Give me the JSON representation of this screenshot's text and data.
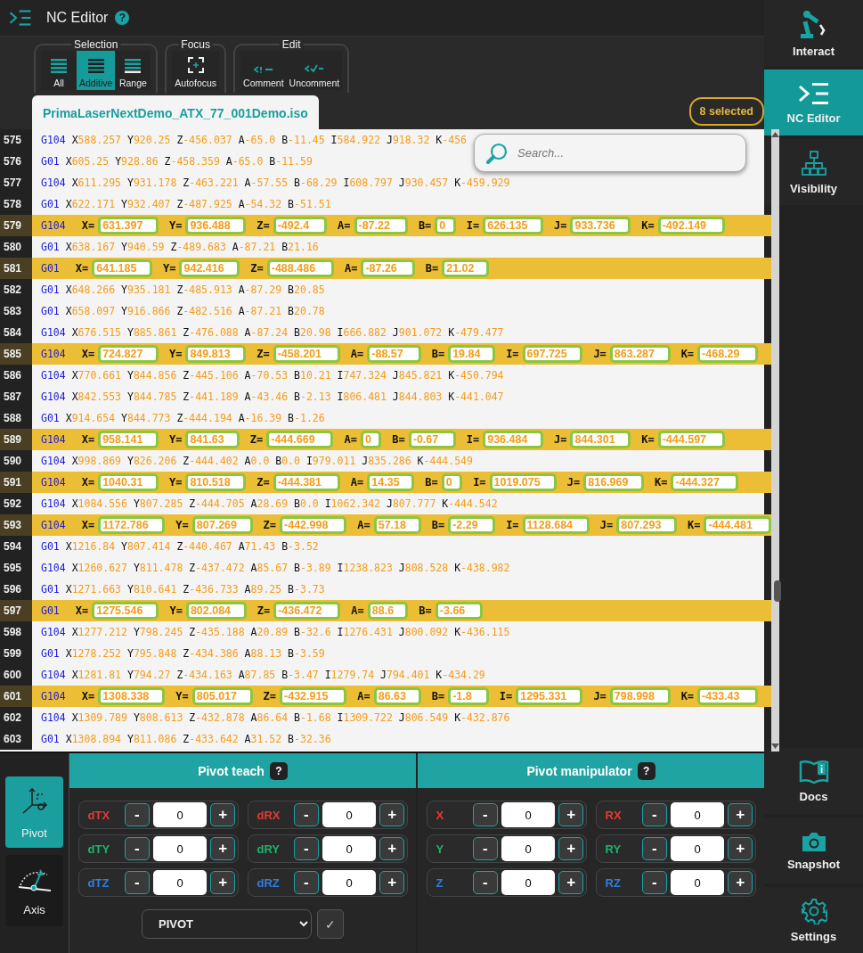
{
  "app": {
    "title": "NC Editor",
    "help": "?"
  },
  "toolbar": [
    {
      "label": "Selection",
      "buttons": [
        {
          "label": "All",
          "kind": "all",
          "selected": false
        },
        {
          "label": "Additive",
          "kind": "additive",
          "selected": true
        },
        {
          "label": "Range",
          "kind": "range",
          "selected": false
        }
      ]
    },
    {
      "label": "Focus",
      "buttons": [
        {
          "label": "Autofocus",
          "kind": "autofocus",
          "selected": false
        }
      ]
    },
    {
      "label": "Edit",
      "buttons": [
        {
          "label": "Comment",
          "kind": "comment",
          "selected": false
        },
        {
          "label": "Uncomment",
          "kind": "uncomment",
          "selected": false
        }
      ]
    }
  ],
  "file_tab": "PrimaLaserNextDemo_ATX_77_001Demo.iso",
  "selection_badge": "8 selected",
  "search": {
    "placeholder": "Search..."
  },
  "lines": [
    {
      "number": "575",
      "selected": false,
      "command": "G104",
      "params": [
        {
          "axis": "X",
          "value": "588.257"
        },
        {
          "axis": "Y",
          "value": "920.25"
        },
        {
          "axis": "Z",
          "value": "-456.037"
        },
        {
          "axis": "A",
          "value": "-65.0"
        },
        {
          "axis": "B",
          "value": "-11.45"
        },
        {
          "axis": "I",
          "value": "584.922"
        },
        {
          "axis": "J",
          "value": "918.32"
        },
        {
          "axis": "K",
          "value": "-456"
        }
      ]
    },
    {
      "number": "576",
      "selected": false,
      "command": "G01",
      "params": [
        {
          "axis": "X",
          "value": "605.25"
        },
        {
          "axis": "Y",
          "value": "928.86"
        },
        {
          "axis": "Z",
          "value": "-458.359"
        },
        {
          "axis": "A",
          "value": "-65.0"
        },
        {
          "axis": "B",
          "value": "-11.59"
        }
      ]
    },
    {
      "number": "577",
      "selected": false,
      "command": "G104",
      "params": [
        {
          "axis": "X",
          "value": "611.295"
        },
        {
          "axis": "Y",
          "value": "931.178"
        },
        {
          "axis": "Z",
          "value": "-463.221"
        },
        {
          "axis": "A",
          "value": "-57.55"
        },
        {
          "axis": "B",
          "value": "-68.29"
        },
        {
          "axis": "I",
          "value": "608.797"
        },
        {
          "axis": "J",
          "value": "930.457"
        },
        {
          "axis": "K",
          "value": "-459.929"
        }
      ]
    },
    {
      "number": "578",
      "selected": false,
      "command": "G01",
      "params": [
        {
          "axis": "X",
          "value": "622.171"
        },
        {
          "axis": "Y",
          "value": "932.407"
        },
        {
          "axis": "Z",
          "value": "-487.925"
        },
        {
          "axis": "A",
          "value": "-54.32"
        },
        {
          "axis": "B",
          "value": "-51.51"
        }
      ]
    },
    {
      "number": "579",
      "selected": true,
      "command": "G104",
      "params": [
        {
          "label": "X=",
          "value": "631.397"
        },
        {
          "label": "Y=",
          "value": "936.488"
        },
        {
          "label": "Z=",
          "value": "-492.4"
        },
        {
          "label": "A=",
          "value": "-87.22"
        },
        {
          "label": "B=",
          "value": "0"
        },
        {
          "label": "I=",
          "value": "626.135"
        },
        {
          "label": "J=",
          "value": "933.736"
        },
        {
          "label": "K=",
          "value": "-492.149"
        }
      ]
    },
    {
      "number": "580",
      "selected": false,
      "command": "G01",
      "params": [
        {
          "axis": "X",
          "value": "638.167"
        },
        {
          "axis": "Y",
          "value": "940.59"
        },
        {
          "axis": "Z",
          "value": "-489.683"
        },
        {
          "axis": "A",
          "value": "-87.21"
        },
        {
          "axis": "B",
          "value": "21.16"
        }
      ]
    },
    {
      "number": "581",
      "selected": true,
      "command": "G01",
      "params": [
        {
          "label": "X=",
          "value": "641.185"
        },
        {
          "label": "Y=",
          "value": "942.416"
        },
        {
          "label": "Z=",
          "value": "-488.486"
        },
        {
          "label": "A=",
          "value": "-87.26"
        },
        {
          "label": "B=",
          "value": "21.02"
        }
      ]
    },
    {
      "number": "582",
      "selected": false,
      "command": "G01",
      "params": [
        {
          "axis": "X",
          "value": "648.266"
        },
        {
          "axis": "Y",
          "value": "935.181"
        },
        {
          "axis": "Z",
          "value": "-485.913"
        },
        {
          "axis": "A",
          "value": "-87.29"
        },
        {
          "axis": "B",
          "value": "20.85"
        }
      ]
    },
    {
      "number": "583",
      "selected": false,
      "command": "G01",
      "params": [
        {
          "axis": "X",
          "value": "658.097"
        },
        {
          "axis": "Y",
          "value": "916.866"
        },
        {
          "axis": "Z",
          "value": "-482.516"
        },
        {
          "axis": "A",
          "value": "-87.21"
        },
        {
          "axis": "B",
          "value": "20.78"
        }
      ]
    },
    {
      "number": "584",
      "selected": false,
      "command": "G104",
      "params": [
        {
          "axis": "X",
          "value": "676.515"
        },
        {
          "axis": "Y",
          "value": "885.861"
        },
        {
          "axis": "Z",
          "value": "-476.088"
        },
        {
          "axis": "A",
          "value": "-87.24"
        },
        {
          "axis": "B",
          "value": "20.98"
        },
        {
          "axis": "I",
          "value": "666.882"
        },
        {
          "axis": "J",
          "value": "901.072"
        },
        {
          "axis": "K",
          "value": "-479.477"
        }
      ]
    },
    {
      "number": "585",
      "selected": true,
      "command": "G104",
      "params": [
        {
          "label": "X=",
          "value": "724.827"
        },
        {
          "label": "Y=",
          "value": "849.813"
        },
        {
          "label": "Z=",
          "value": "-458.201"
        },
        {
          "label": "A=",
          "value": "-88.57"
        },
        {
          "label": "B=",
          "value": "19.84"
        },
        {
          "label": "I=",
          "value": "697.725"
        },
        {
          "label": "J=",
          "value": "863.287"
        },
        {
          "label": "K=",
          "value": "-468.29"
        }
      ]
    },
    {
      "number": "586",
      "selected": false,
      "command": "G104",
      "params": [
        {
          "axis": "X",
          "value": "770.661"
        },
        {
          "axis": "Y",
          "value": "844.856"
        },
        {
          "axis": "Z",
          "value": "-445.106"
        },
        {
          "axis": "A",
          "value": "-70.53"
        },
        {
          "axis": "B",
          "value": "10.21"
        },
        {
          "axis": "I",
          "value": "747.324"
        },
        {
          "axis": "J",
          "value": "845.821"
        },
        {
          "axis": "K",
          "value": "-450.794"
        }
      ]
    },
    {
      "number": "587",
      "selected": false,
      "command": "G104",
      "params": [
        {
          "axis": "X",
          "value": "842.553"
        },
        {
          "axis": "Y",
          "value": "844.785"
        },
        {
          "axis": "Z",
          "value": "-441.189"
        },
        {
          "axis": "A",
          "value": "-43.46"
        },
        {
          "axis": "B",
          "value": "-2.13"
        },
        {
          "axis": "I",
          "value": "806.481"
        },
        {
          "axis": "J",
          "value": "844.803"
        },
        {
          "axis": "K",
          "value": "-441.047"
        }
      ]
    },
    {
      "number": "588",
      "selected": false,
      "command": "G01",
      "params": [
        {
          "axis": "X",
          "value": "914.654"
        },
        {
          "axis": "Y",
          "value": "844.773"
        },
        {
          "axis": "Z",
          "value": "-444.194"
        },
        {
          "axis": "A",
          "value": "-16.39"
        },
        {
          "axis": "B",
          "value": "-1.26"
        }
      ]
    },
    {
      "number": "589",
      "selected": true,
      "command": "G104",
      "params": [
        {
          "label": "X=",
          "value": "958.141"
        },
        {
          "label": "Y=",
          "value": "841.63"
        },
        {
          "label": "Z=",
          "value": "-444.669"
        },
        {
          "label": "A=",
          "value": "0"
        },
        {
          "label": "B=",
          "value": "-0.67"
        },
        {
          "label": "I=",
          "value": "936.484"
        },
        {
          "label": "J=",
          "value": "844.301"
        },
        {
          "label": "K=",
          "value": "-444.597"
        }
      ]
    },
    {
      "number": "590",
      "selected": false,
      "command": "G104",
      "params": [
        {
          "axis": "X",
          "value": "998.869"
        },
        {
          "axis": "Y",
          "value": "826.206"
        },
        {
          "axis": "Z",
          "value": "-444.402"
        },
        {
          "axis": "A",
          "value": "0.0"
        },
        {
          "axis": "B",
          "value": "0.0"
        },
        {
          "axis": "I",
          "value": "979.011"
        },
        {
          "axis": "J",
          "value": "835.286"
        },
        {
          "axis": "K",
          "value": "-444.549"
        }
      ]
    },
    {
      "number": "591",
      "selected": true,
      "command": "G104",
      "params": [
        {
          "label": "X=",
          "value": "1040.31"
        },
        {
          "label": "Y=",
          "value": "810.518"
        },
        {
          "label": "Z=",
          "value": "-444.381"
        },
        {
          "label": "A=",
          "value": "14.35"
        },
        {
          "label": "B=",
          "value": "0"
        },
        {
          "label": "I=",
          "value": "1019.075"
        },
        {
          "label": "J=",
          "value": "816.969"
        },
        {
          "label": "K=",
          "value": "-444.327"
        }
      ]
    },
    {
      "number": "592",
      "selected": false,
      "command": "G104",
      "params": [
        {
          "axis": "X",
          "value": "1084.556"
        },
        {
          "axis": "Y",
          "value": "807.285"
        },
        {
          "axis": "Z",
          "value": "-444.705"
        },
        {
          "axis": "A",
          "value": "28.69"
        },
        {
          "axis": "B",
          "value": "0.0"
        },
        {
          "axis": "I",
          "value": "1062.342"
        },
        {
          "axis": "J",
          "value": "807.777"
        },
        {
          "axis": "K",
          "value": "-444.542"
        }
      ]
    },
    {
      "number": "593",
      "selected": true,
      "command": "G104",
      "params": [
        {
          "label": "X=",
          "value": "1172.786"
        },
        {
          "label": "Y=",
          "value": "807.269"
        },
        {
          "label": "Z=",
          "value": "-442.998"
        },
        {
          "label": "A=",
          "value": "57.18"
        },
        {
          "label": "B=",
          "value": "-2.29"
        },
        {
          "label": "I=",
          "value": "1128.684"
        },
        {
          "label": "J=",
          "value": "807.293"
        },
        {
          "label": "K=",
          "value": "-444.481"
        }
      ]
    },
    {
      "number": "594",
      "selected": false,
      "command": "G01",
      "params": [
        {
          "axis": "X",
          "value": "1216.84"
        },
        {
          "axis": "Y",
          "value": "807.414"
        },
        {
          "axis": "Z",
          "value": "-440.467"
        },
        {
          "axis": "A",
          "value": "71.43"
        },
        {
          "axis": "B",
          "value": "-3.52"
        }
      ]
    },
    {
      "number": "595",
      "selected": false,
      "command": "G104",
      "params": [
        {
          "axis": "X",
          "value": "1260.627"
        },
        {
          "axis": "Y",
          "value": "811.478"
        },
        {
          "axis": "Z",
          "value": "-437.472"
        },
        {
          "axis": "A",
          "value": "85.67"
        },
        {
          "axis": "B",
          "value": "-3.89"
        },
        {
          "axis": "I",
          "value": "1238.823"
        },
        {
          "axis": "J",
          "value": "808.528"
        },
        {
          "axis": "K",
          "value": "-438.982"
        }
      ]
    },
    {
      "number": "596",
      "selected": false,
      "command": "G01",
      "params": [
        {
          "axis": "X",
          "value": "1271.663"
        },
        {
          "axis": "Y",
          "value": "810.641"
        },
        {
          "axis": "Z",
          "value": "-436.733"
        },
        {
          "axis": "A",
          "value": "89.25"
        },
        {
          "axis": "B",
          "value": "-3.73"
        }
      ]
    },
    {
      "number": "597",
      "selected": true,
      "command": "G01",
      "params": [
        {
          "label": "X=",
          "value": "1275.546"
        },
        {
          "label": "Y=",
          "value": "802.084"
        },
        {
          "label": "Z=",
          "value": "-436.472"
        },
        {
          "label": "A=",
          "value": "88.6"
        },
        {
          "label": "B=",
          "value": "-3.66"
        }
      ]
    },
    {
      "number": "598",
      "selected": false,
      "command": "G104",
      "params": [
        {
          "axis": "X",
          "value": "1277.212"
        },
        {
          "axis": "Y",
          "value": "798.245"
        },
        {
          "axis": "Z",
          "value": "-435.188"
        },
        {
          "axis": "A",
          "value": "20.89"
        },
        {
          "axis": "B",
          "value": "-32.6"
        },
        {
          "axis": "I",
          "value": "1276.431"
        },
        {
          "axis": "J",
          "value": "800.092"
        },
        {
          "axis": "K",
          "value": "-436.115"
        }
      ]
    },
    {
      "number": "599",
      "selected": false,
      "command": "G01",
      "params": [
        {
          "axis": "X",
          "value": "1278.252"
        },
        {
          "axis": "Y",
          "value": "795.848"
        },
        {
          "axis": "Z",
          "value": "-434.386"
        },
        {
          "axis": "A",
          "value": "88.13"
        },
        {
          "axis": "B",
          "value": "-3.59"
        }
      ]
    },
    {
      "number": "600",
      "selected": false,
      "command": "G104",
      "params": [
        {
          "axis": "X",
          "value": "1281.81"
        },
        {
          "axis": "Y",
          "value": "794.27"
        },
        {
          "axis": "Z",
          "value": "-434.163"
        },
        {
          "axis": "A",
          "value": "87.85"
        },
        {
          "axis": "B",
          "value": "-3.47"
        },
        {
          "axis": "I",
          "value": "1279.74"
        },
        {
          "axis": "J",
          "value": "794.401"
        },
        {
          "axis": "K",
          "value": "-434.29"
        }
      ]
    },
    {
      "number": "601",
      "selected": true,
      "command": "G104",
      "params": [
        {
          "label": "X=",
          "value": "1308.338"
        },
        {
          "label": "Y=",
          "value": "805.017"
        },
        {
          "label": "Z=",
          "value": "-432.915"
        },
        {
          "label": "A=",
          "value": "86.63"
        },
        {
          "label": "B=",
          "value": "-1.8"
        },
        {
          "label": "I=",
          "value": "1295.331"
        },
        {
          "label": "J=",
          "value": "798.998"
        },
        {
          "label": "K=",
          "value": "-433.43"
        }
      ]
    },
    {
      "number": "602",
      "selected": false,
      "command": "G104",
      "params": [
        {
          "axis": "X",
          "value": "1309.789"
        },
        {
          "axis": "Y",
          "value": "808.613"
        },
        {
          "axis": "Z",
          "value": "-432.878"
        },
        {
          "axis": "A",
          "value": "86.64"
        },
        {
          "axis": "B",
          "value": "-1.68"
        },
        {
          "axis": "I",
          "value": "1309.722"
        },
        {
          "axis": "J",
          "value": "806.549"
        },
        {
          "axis": "K",
          "value": "-432.876"
        }
      ]
    },
    {
      "number": "603",
      "selected": false,
      "command": "G01",
      "params": [
        {
          "axis": "X",
          "value": "1308.894"
        },
        {
          "axis": "Y",
          "value": "811.086"
        },
        {
          "axis": "Z",
          "value": "-433.642"
        },
        {
          "axis": "A",
          "value": "31.52"
        },
        {
          "axis": "B",
          "value": "-32.36"
        }
      ]
    }
  ],
  "side_tabs": [
    {
      "label": "Pivot",
      "kind": "pivot",
      "selected": true
    },
    {
      "label": "Axis",
      "kind": "axis",
      "selected": false
    }
  ],
  "panels": [
    {
      "title": "Pivot teach",
      "help": "?",
      "controls": [
        {
          "label": "dTX",
          "color": "#e53935",
          "minus": "-",
          "value": "0",
          "plus": "+"
        },
        {
          "label": "dRX",
          "color": "#e53935",
          "minus": "-",
          "value": "0",
          "plus": "+"
        },
        {
          "label": "dTY",
          "color": "#1fb36b",
          "minus": "-",
          "value": "0",
          "plus": "+"
        },
        {
          "label": "dRY",
          "color": "#1fb36b",
          "minus": "-",
          "value": "0",
          "plus": "+"
        },
        {
          "label": "dTZ",
          "color": "#2f7fe0",
          "minus": "-",
          "value": "0",
          "plus": "+"
        },
        {
          "label": "dRZ",
          "color": "#2f7fe0",
          "minus": "-",
          "value": "0",
          "plus": "+"
        }
      ],
      "mode_select": "PIVOT",
      "confirm": "✓"
    },
    {
      "title": "Pivot manipulator",
      "help": "?",
      "controls": [
        {
          "label": "X",
          "color": "#e53935",
          "minus": "-",
          "value": "0",
          "plus": "+"
        },
        {
          "label": "RX",
          "color": "#e53935",
          "minus": "-",
          "value": "0",
          "plus": "+"
        },
        {
          "label": "Y",
          "color": "#1fb36b",
          "minus": "-",
          "value": "0",
          "plus": "+"
        },
        {
          "label": "RY",
          "color": "#1fb36b",
          "minus": "-",
          "value": "0",
          "plus": "+"
        },
        {
          "label": "Z",
          "color": "#2f7fe0",
          "minus": "-",
          "value": "0",
          "plus": "+"
        },
        {
          "label": "RZ",
          "color": "#2f7fe0",
          "minus": "-",
          "value": "0",
          "plus": "+"
        }
      ]
    }
  ],
  "sidebar": {
    "top": [
      {
        "label": "Interact",
        "kind": "interact",
        "selected": false
      },
      {
        "label": "NC Editor",
        "kind": "editor",
        "selected": true
      },
      {
        "label": "Visibility",
        "kind": "visibility",
        "selected": false
      }
    ],
    "bottom": [
      {
        "label": "Docs",
        "kind": "docs",
        "selected": false
      },
      {
        "label": "Snapshot",
        "kind": "snapshot",
        "selected": false
      },
      {
        "label": "Settings",
        "kind": "settings",
        "selected": false
      }
    ]
  }
}
